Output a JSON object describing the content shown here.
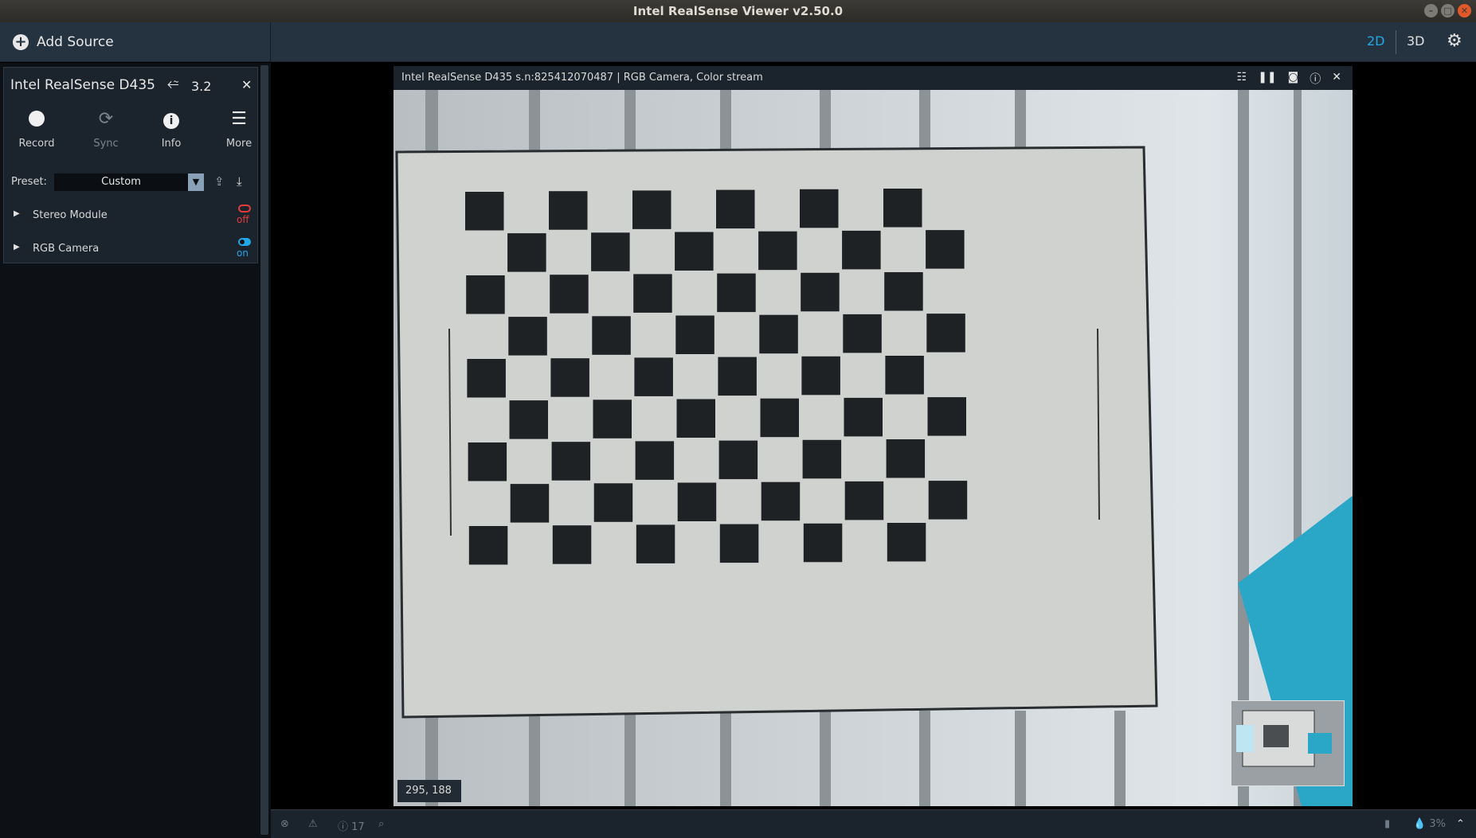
{
  "window": {
    "title": "Intel RealSense Viewer v2.50.0"
  },
  "toolbar": {
    "add_source_label": "Add Source",
    "mode_2d": "2D",
    "mode_3d": "3D"
  },
  "device": {
    "name": "Intel RealSense D435",
    "usb_version": "3.2",
    "buttons": [
      {
        "label": "Record",
        "icon": "record-icon"
      },
      {
        "label": "Sync",
        "icon": "sync-icon"
      },
      {
        "label": "Info",
        "icon": "info-icon"
      },
      {
        "label": "More",
        "icon": "menu-icon"
      }
    ],
    "preset_label": "Preset:",
    "preset_value": "Custom",
    "sensors": [
      {
        "name": "Stereo Module",
        "state": "off"
      },
      {
        "name": "RGB Camera",
        "state": "on"
      }
    ]
  },
  "stream": {
    "title": "Intel RealSense D435 s.n:825412070487 | RGB Camera, Color stream",
    "pixel_readout": "295, 188"
  },
  "statusbar": {
    "info_count": "17",
    "usage": "3%"
  },
  "colors": {
    "accent": "#22a8e6",
    "off": "#e53b3b",
    "panel": "#1b232c",
    "toolbar": "#253240"
  }
}
